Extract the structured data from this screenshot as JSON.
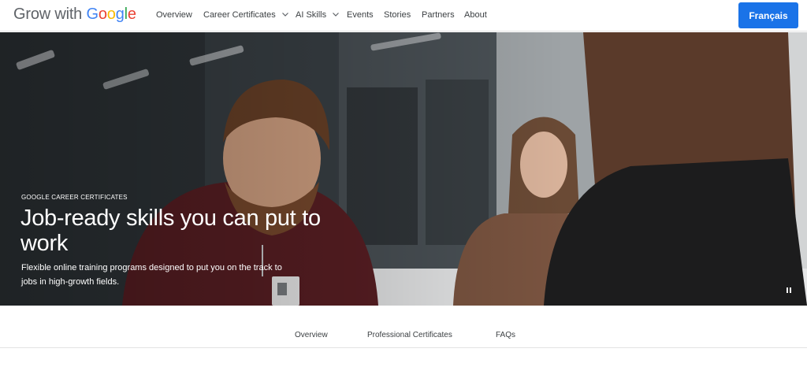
{
  "brand": {
    "prefix": "Grow with ",
    "google": [
      "G",
      "o",
      "o",
      "g",
      "l",
      "e"
    ]
  },
  "nav": {
    "items": [
      {
        "label": "Overview",
        "has_dropdown": false
      },
      {
        "label": "Career Certificates",
        "has_dropdown": true
      },
      {
        "label": "AI Skills",
        "has_dropdown": true
      },
      {
        "label": "Events",
        "has_dropdown": false
      },
      {
        "label": "Stories",
        "has_dropdown": false
      },
      {
        "label": "Partners",
        "has_dropdown": false
      },
      {
        "label": "About",
        "has_dropdown": false
      }
    ],
    "language_button": "Français"
  },
  "hero": {
    "eyebrow": "GOOGLE CAREER CERTIFICATES",
    "title": "Job-ready skills you can put to work",
    "subtitle": "Flexible online training programs designed to put you on the track to jobs in high-growth fields.",
    "pause_icon": "pause-icon"
  },
  "subnav": {
    "items": [
      "Overview",
      "Professional Certificates",
      "FAQs"
    ]
  },
  "colors": {
    "accent": "#1a73e8",
    "google_blue": "#4285F4",
    "google_red": "#EA4335",
    "google_yellow": "#FBBC05",
    "google_green": "#34A853"
  }
}
